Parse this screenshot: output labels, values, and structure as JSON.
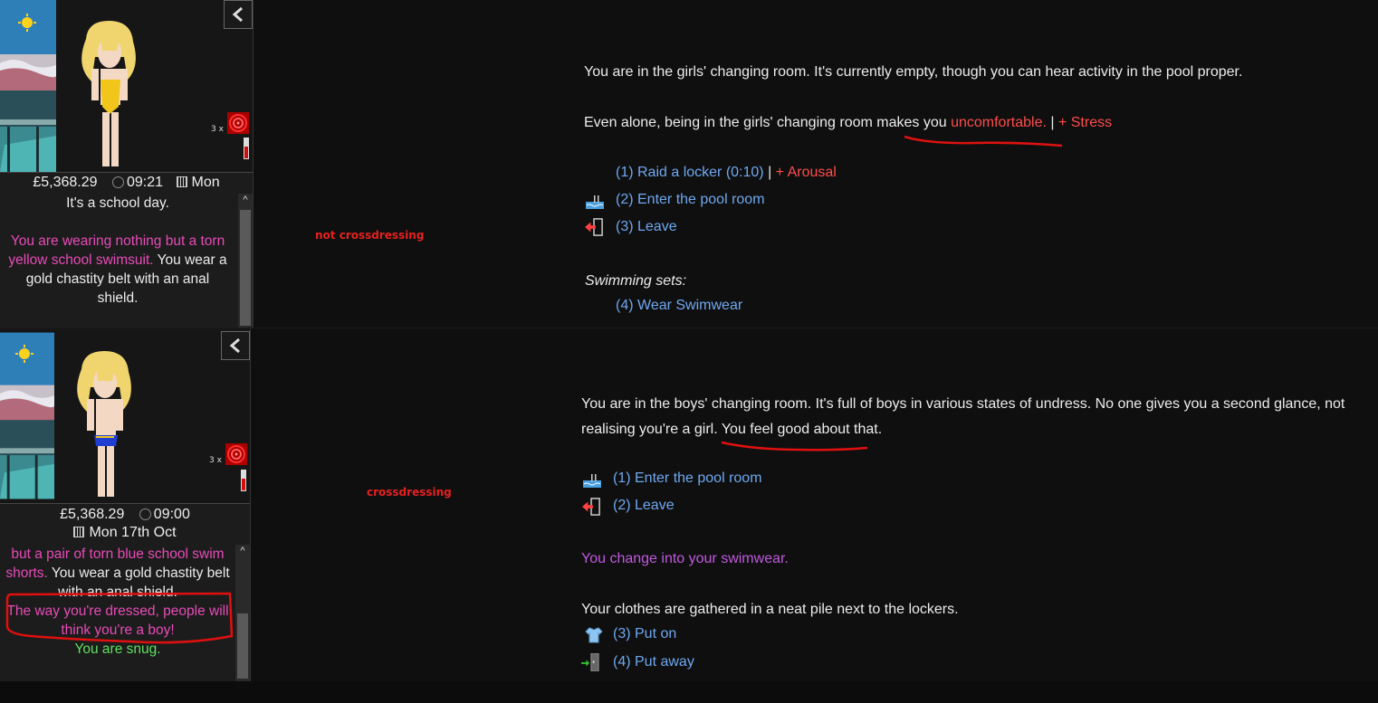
{
  "top": {
    "label": "not crossdressing",
    "sidebar": {
      "multiplier": "3 x",
      "money": "£5,368.29",
      "time": "09:21",
      "date": "Mon",
      "desc_line1": "It's a school day.",
      "desc_pink": "You are wearing nothing but a torn yellow school swimsuit.",
      "desc_white": " You wear a gold chastity belt with an anal shield."
    },
    "main": {
      "line1": "You are in the girls' changing room. It's currently empty, though you can hear activity in the pool proper.",
      "line2_pre": "Even alone, being in the girls' changing room makes you ",
      "line2_red": "uncomfortable.",
      "line2_sep": " | ",
      "line2_stress": "+ Stress",
      "options": [
        {
          "label": "(1) Raid a locker (0:10)",
          "sep": " | ",
          "extra": "+ Arousal",
          "icon": "none"
        },
        {
          "label": "(2) Enter the pool room",
          "icon": "pool-icon"
        },
        {
          "label": "(3) Leave",
          "icon": "exit-door-icon"
        }
      ],
      "sets_title": "Swimming sets:",
      "sets_option": "(4) Wear Swimwear"
    }
  },
  "bottom": {
    "label": "crossdressing",
    "sidebar": {
      "multiplier": "3 x",
      "money": "£5,368.29",
      "time": "09:00",
      "date": "Mon 17th Oct",
      "desc_pink1": "but a pair of torn blue school swim shorts.",
      "desc_white1": " You wear a gold chastity belt with an anal shield.",
      "desc_pink2": "The way you're dressed, people will think you're a boy!",
      "desc_green": "You are snug."
    },
    "main": {
      "line1": "You are in the boys' changing room. It's full of boys in various states of undress. No one gives you a second glance, not realising you're a girl.",
      "line1_tail": " You feel good about that.",
      "options": [
        {
          "label": "(1) Enter the pool room",
          "icon": "pool-icon"
        },
        {
          "label": "(2) Leave",
          "icon": "exit-door-icon"
        }
      ],
      "change_msg": "You change into your swimwear.",
      "clothes_msg": "Your clothes are gathered in a neat pile next to the lockers.",
      "put_on": "(3) Put on",
      "put_away": "(4) Put away"
    }
  },
  "colors": {
    "pink": "#e84bb8",
    "red": "#ff4c4c",
    "link": "#6fa8f0",
    "purple": "#c05ae0",
    "green": "#5fe05f",
    "annotation": "#e62020"
  }
}
